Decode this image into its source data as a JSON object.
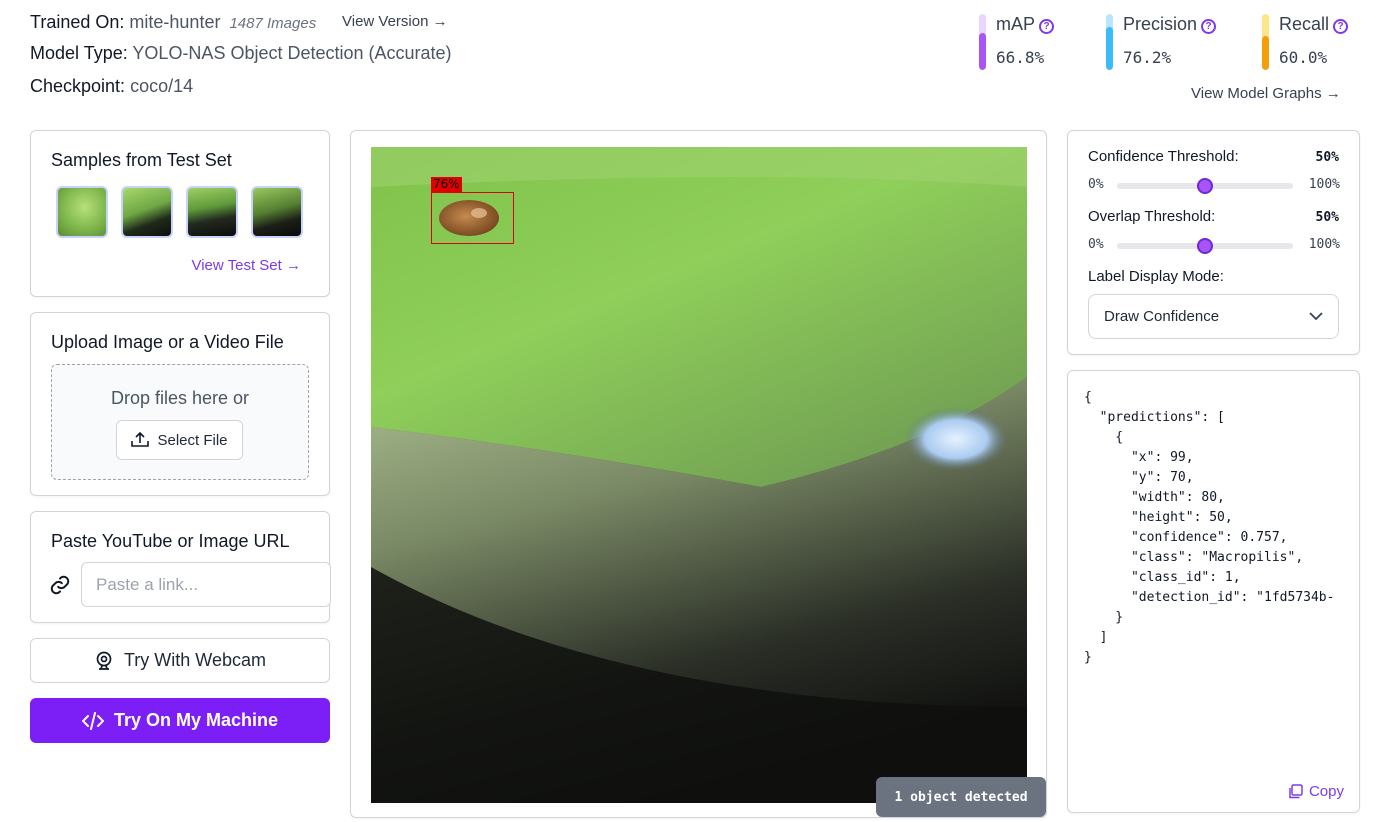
{
  "header": {
    "trained_on_label": "Trained On:",
    "trained_on_value": "mite-hunter",
    "image_count": "1487 Images",
    "view_version": "View Version",
    "model_type_label": "Model Type:",
    "model_type_value": "YOLO-NAS Object Detection (Accurate)",
    "checkpoint_label": "Checkpoint:",
    "checkpoint_value": "coco/14"
  },
  "metrics": [
    {
      "name": "mAP",
      "value": "66.8%",
      "level": 0.668,
      "color": "#a855f7",
      "track": "#e9d5ff"
    },
    {
      "name": "Precision",
      "value": "76.2%",
      "level": 0.762,
      "color": "#38bdf8",
      "track": "#bae6fd"
    },
    {
      "name": "Recall",
      "value": "60.0%",
      "level": 0.6,
      "color": "#f59e0b",
      "track": "#fde68a"
    }
  ],
  "view_graphs": "View Model Graphs",
  "samples": {
    "title": "Samples from Test Set",
    "link": "View Test Set"
  },
  "upload": {
    "title": "Upload Image or a Video File",
    "drop_text": "Drop files here or",
    "button": "Select File"
  },
  "paste": {
    "title": "Paste YouTube or Image URL",
    "placeholder": "Paste a link..."
  },
  "webcam_button": "Try With Webcam",
  "machine_button": "Try On My Machine",
  "viewer": {
    "detection_label": "76%",
    "status": "1 object detected"
  },
  "controls": {
    "confidence": {
      "label": "Confidence Threshold:",
      "value": "50%",
      "min": "0%",
      "max": "100%",
      "level": 0.5
    },
    "overlap": {
      "label": "Overlap Threshold:",
      "value": "50%",
      "min": "0%",
      "max": "100%",
      "level": 0.5
    },
    "label_mode_label": "Label Display Mode:",
    "label_mode_value": "Draw Confidence"
  },
  "json_output": "{\n  \"predictions\": [\n    {\n      \"x\": 99,\n      \"y\": 70,\n      \"width\": 80,\n      \"height\": 50,\n      \"confidence\": 0.757,\n      \"class\": \"Macropilis\",\n      \"class_id\": 1,\n      \"detection_id\": \"1fd5734b-\n    }\n  ]\n}",
  "copy_label": "Copy",
  "accent_color": "#7c1ff6"
}
